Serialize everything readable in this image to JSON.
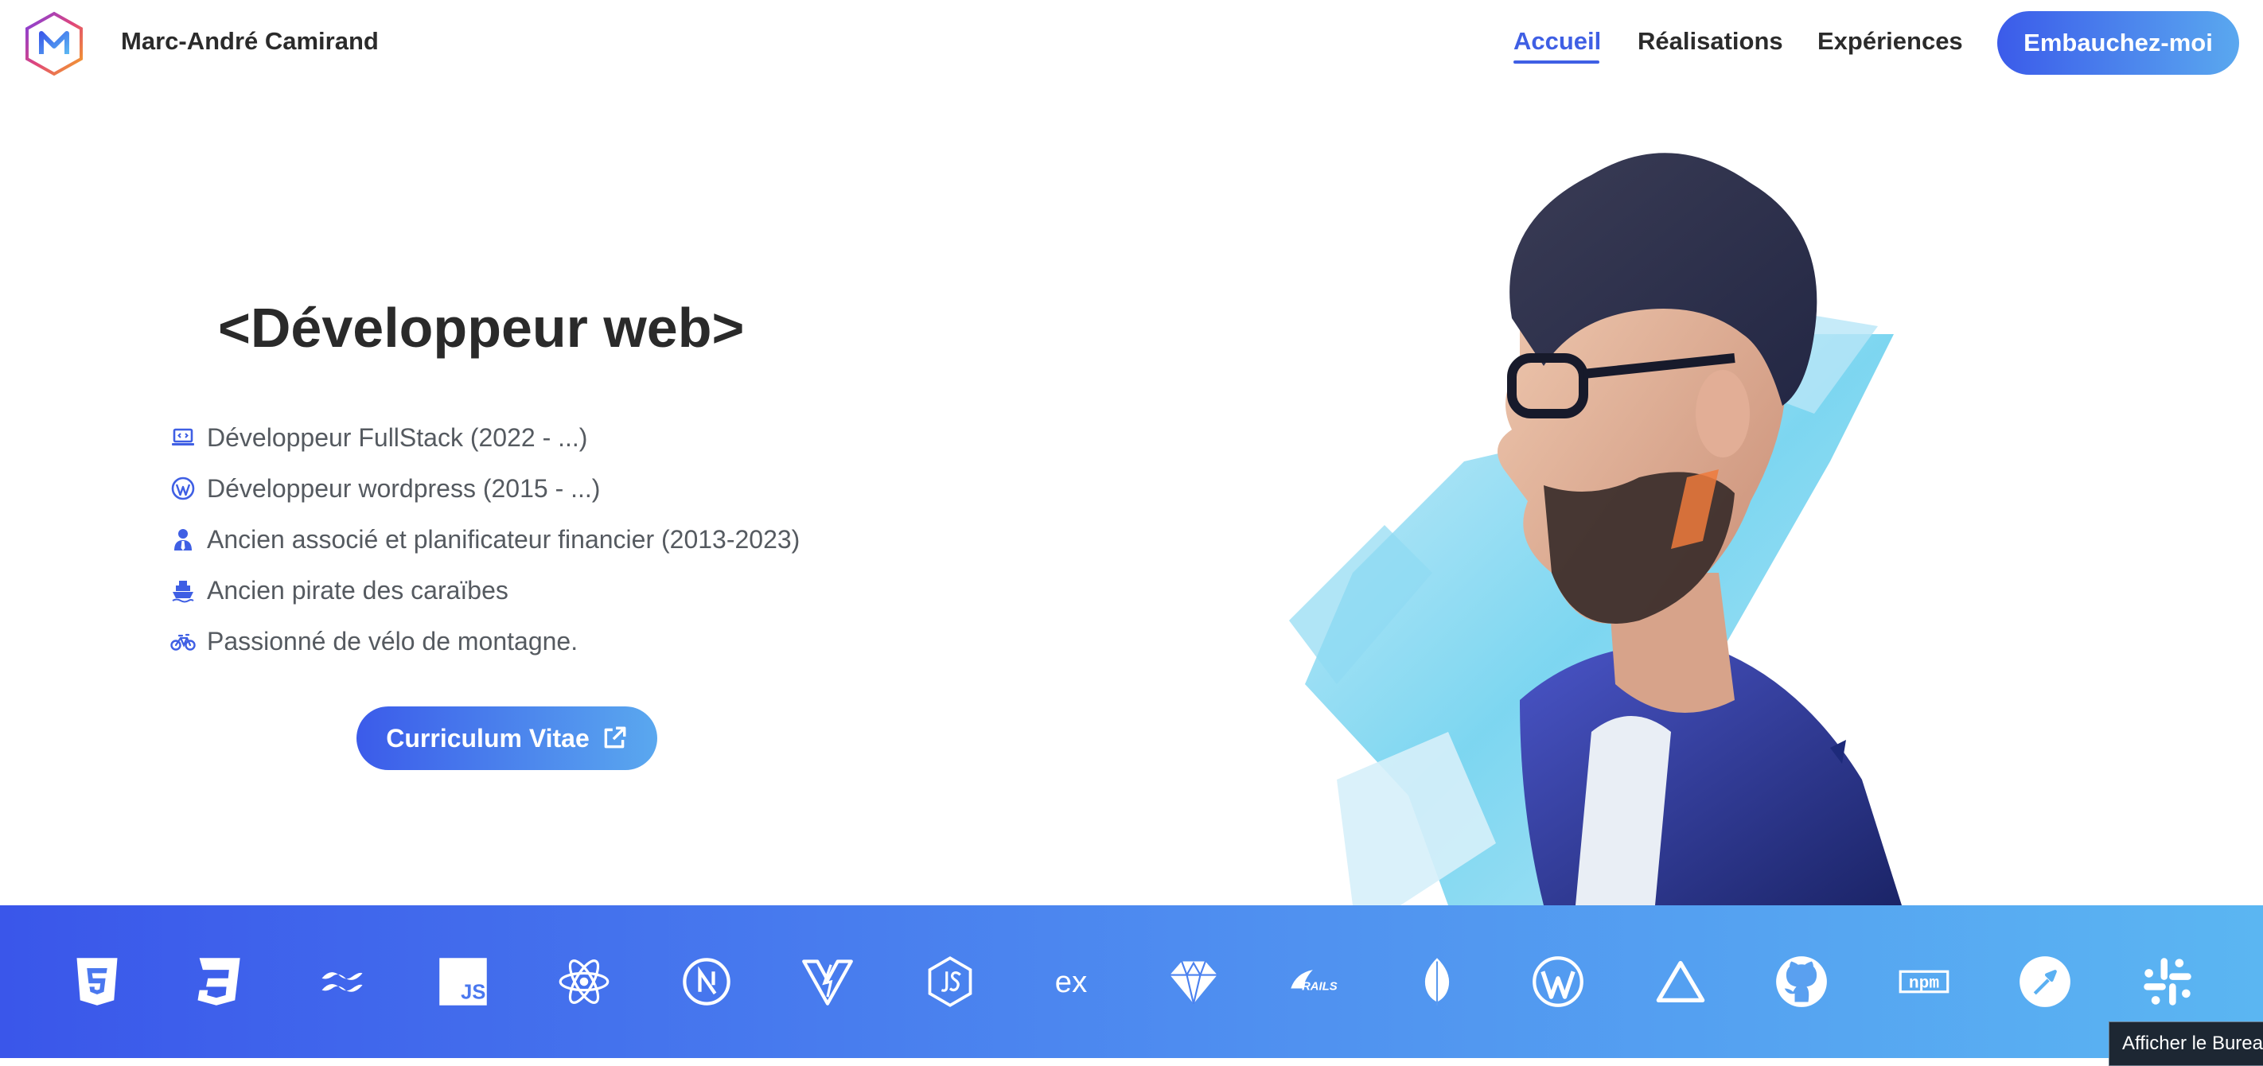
{
  "header": {
    "brand_name": "Marc-André Camirand",
    "nav": [
      {
        "label": "Accueil",
        "active": true
      },
      {
        "label": "Réalisations",
        "active": false
      },
      {
        "label": "Expériences",
        "active": false
      }
    ],
    "cta_label": "Embauchez-moi"
  },
  "hero": {
    "headline": "<Développeur web>",
    "features": [
      {
        "icon": "laptop-code-icon",
        "text": "Développeur FullStack (2022 - ...)"
      },
      {
        "icon": "wordpress-icon",
        "text": "Développeur wordpress (2015 - ...)"
      },
      {
        "icon": "user-tie-icon",
        "text": "Ancien associé et planificateur financier (2013-2023)"
      },
      {
        "icon": "ship-icon",
        "text": "Ancien pirate des caraïbes"
      },
      {
        "icon": "bicycle-icon",
        "text": "Passionné de vélo de montagne."
      }
    ],
    "cv_button_label": "Curriculum Vitae"
  },
  "tech_stack": [
    "html5-icon",
    "css3-icon",
    "tailwind-icon",
    "javascript-icon",
    "react-icon",
    "nextjs-icon",
    "vite-icon",
    "nodejs-icon",
    "express-icon",
    "ruby-icon",
    "rails-icon",
    "mongodb-icon",
    "wordpress-icon",
    "vercel-icon",
    "github-icon",
    "npm-icon",
    "postman-icon",
    "slack-icon"
  ],
  "tech_labels": {
    "javascript": "JS",
    "express": "ex",
    "rails": "RAILS",
    "npm": "npm"
  },
  "tooltip": "Afficher le Bureau",
  "colors": {
    "accent": "#3f5fe4",
    "gradient_start": "#3b5bea",
    "gradient_end": "#5aa8ef",
    "text": "#2a2a2a",
    "muted": "#555a60"
  }
}
